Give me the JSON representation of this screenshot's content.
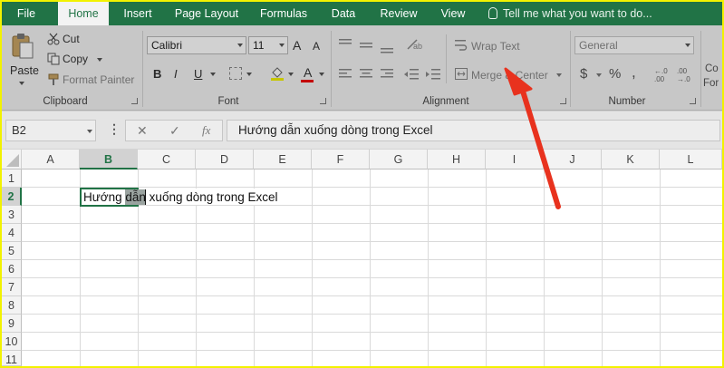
{
  "tabs": [
    {
      "label": "File",
      "active": false
    },
    {
      "label": "Home",
      "active": true
    },
    {
      "label": "Insert",
      "active": false
    },
    {
      "label": "Page Layout",
      "active": false
    },
    {
      "label": "Formulas",
      "active": false
    },
    {
      "label": "Data",
      "active": false
    },
    {
      "label": "Review",
      "active": false
    },
    {
      "label": "View",
      "active": false
    }
  ],
  "tell_me": "Tell me what you want to do...",
  "clipboard": {
    "paste": "Paste",
    "cut": "Cut",
    "copy": "Copy",
    "format_painter": "Format Painter",
    "label": "Clipboard"
  },
  "font": {
    "name": "Calibri",
    "size": "11",
    "bold": "B",
    "italic": "I",
    "underline": "U",
    "grow": "A",
    "shrink": "A",
    "color_letter": "A",
    "label": "Font"
  },
  "alignment": {
    "wrap_text": "Wrap Text",
    "merge_center": "Merge & Center",
    "label": "Alignment"
  },
  "number": {
    "format": "General",
    "currency": "$",
    "percent": "%",
    "comma": ",",
    "inc_decimal": "←.0 .00",
    "dec_decimal": ".00 →.0",
    "label": "Number"
  },
  "styles_partial": {
    "top": "Co",
    "bottom": "For"
  },
  "formula_bar": {
    "name_box": "B2",
    "cancel": "✕",
    "enter": "✓",
    "fx": "fx",
    "content": "Hướng dẫn xuống dòng trong Excel"
  },
  "sheet": {
    "columns": [
      "A",
      "B",
      "C",
      "D",
      "E",
      "F",
      "G",
      "H",
      "I",
      "J",
      "K",
      "L"
    ],
    "rows": [
      "1",
      "2",
      "3",
      "4",
      "5",
      "6",
      "7",
      "8",
      "9",
      "10",
      "11"
    ],
    "selected_column": "B",
    "selected_row": "2",
    "cell_b2": "Hướng dẫn xuống dòng trong Excel"
  },
  "colors": {
    "excel_green": "#217346",
    "border_yellow": "#f2f200",
    "arrow_red": "#e8321e"
  }
}
